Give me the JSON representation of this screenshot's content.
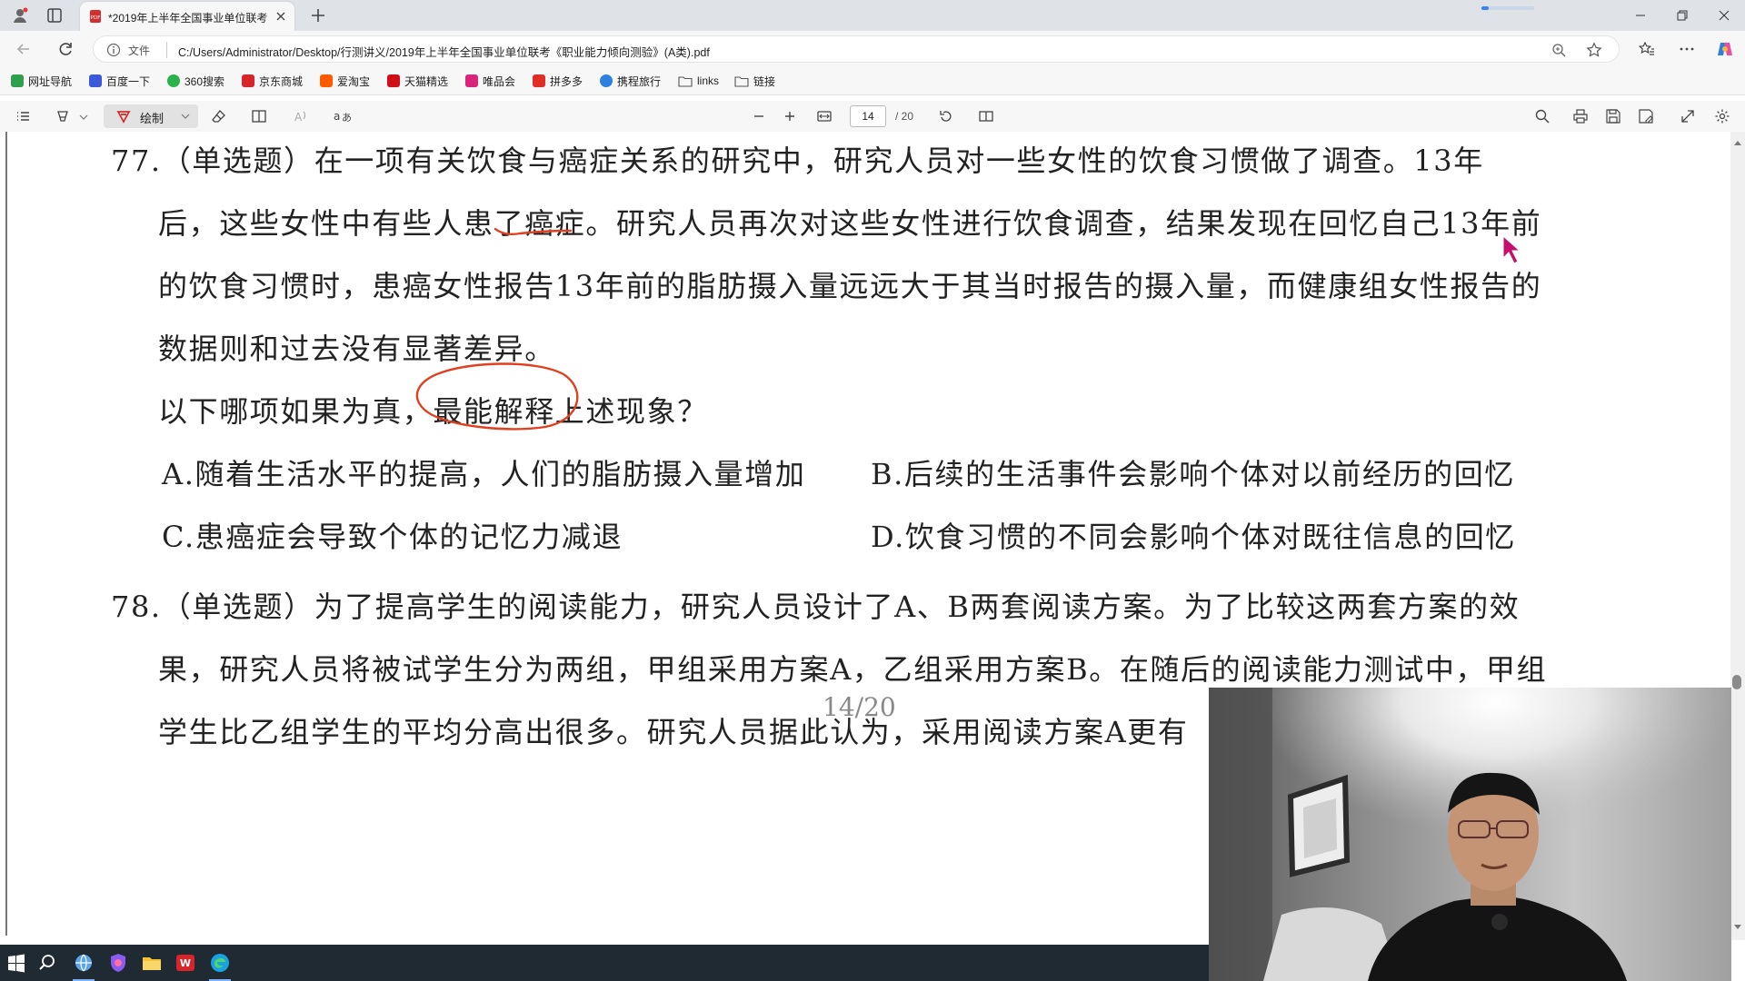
{
  "browser": {
    "tab_title": "*2019年上半年全国事业单位联考",
    "url_scheme": "文件",
    "url": "C:/Users/Administrator/Desktop/行测讲义/2019年上半年全国事业单位联考《职业能力倾向测验》(A类).pdf",
    "bookmarks": [
      {
        "label": "网址导航",
        "color": "#2e9e4f"
      },
      {
        "label": "百度一下",
        "color": "#3a5ad9"
      },
      {
        "label": "360搜索",
        "color": "#2bb24c"
      },
      {
        "label": "京东商城",
        "color": "#d7252c"
      },
      {
        "label": "爱淘宝",
        "color": "#ff5a00"
      },
      {
        "label": "天猫精选",
        "color": "#d10d17"
      },
      {
        "label": "唯品会",
        "color": "#d8247a"
      },
      {
        "label": "拼多多",
        "color": "#e02e24"
      },
      {
        "label": "携程旅行",
        "color": "#2d7fe0"
      },
      {
        "label": "links",
        "color": "#666666"
      },
      {
        "label": "链接",
        "color": "#666666"
      }
    ]
  },
  "pdf_toolbar": {
    "draw_label": "绘制",
    "current_page": "14",
    "total_pages": "/ 20",
    "accent_color": "#d32f2f"
  },
  "document": {
    "q77": {
      "lines": [
        "77.（单选题）在一项有关饮食与癌症关系的研究中，研究人员对一些女性的饮食习惯做了调查。13年",
        "后，这些女性中有些人患了癌症。研究人员再次对这些女性进行饮食调查，结果发现在回忆自己13年前",
        "的饮食习惯时，患癌女性报告13年前的脂肪摄入量远远大于其当时报告的摄入量，而健康组女性报告的",
        "数据则和过去没有显著差异。",
        "以下哪项如果为真，最能解释上述现象？"
      ],
      "options": {
        "A": "A.随着生活水平的提高，人们的脂肪摄入量增加",
        "B": "B.后续的生活事件会影响个体对以前经历的回忆",
        "C": "C.患癌症会导致个体的记忆力减退",
        "D": "D.饮食习惯的不同会影响个体对既往信息的回忆"
      }
    },
    "q78": {
      "lines": [
        "78.（单选题）为了提高学生的阅读能力，研究人员设计了A、B两套阅读方案。为了比较这两套方案的效",
        "果，研究人员将被试学生分为两组，甲组采用方案A，乙组采用方案B。在随后的阅读能力测试中，甲组",
        "学生比乙组学生的平均分高出很多。研究人员据此认为，采用阅读方案A更有"
      ]
    },
    "page_footer": "14/20",
    "annotation_color": "#e0401f"
  }
}
